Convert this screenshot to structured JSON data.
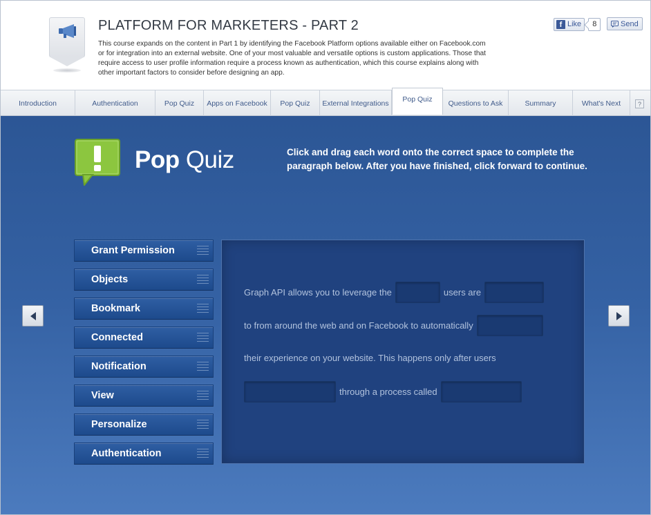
{
  "header": {
    "title": "PLATFORM FOR MARKETERS - PART 2",
    "description": "This course expands on the content in Part 1 by identifying the Facebook Platform options available either on Facebook.com or for integration into an external website. One of your most valuable and versatile options is custom applications. Those that require access to user profile information require a process known as authentication, which this course explains along with other important factors to consider before designing an app.",
    "like_label": "Like",
    "like_count": "8",
    "send_label": "Send"
  },
  "nav": {
    "tabs": [
      {
        "label": "Introduction"
      },
      {
        "label": "Authentication"
      },
      {
        "label": "Pop Quiz"
      },
      {
        "label": "Apps on Facebook"
      },
      {
        "label": "Pop Quiz"
      },
      {
        "label": "External Integrations"
      },
      {
        "label": "Pop Quiz"
      },
      {
        "label": "Questions to Ask"
      },
      {
        "label": "Summary"
      },
      {
        "label": "What's Next"
      }
    ],
    "active_index": 6,
    "help_label": "?"
  },
  "quiz": {
    "title_bold": "Pop",
    "title_light": " Quiz",
    "instructions": "Click and drag each word onto the correct space to complete the paragraph below. After you have finished, click forward to continue.",
    "words": [
      "Grant Permission",
      "Objects",
      "Bookmark",
      "Connected",
      "Notification",
      "View",
      "Personalize",
      "Authentication"
    ],
    "paragraph": {
      "l1a": "Graph API allows you to leverage the",
      "l1b": "users are",
      "l2a": "to from around the web and on Facebook to automatically",
      "l3a": "their experience on your website. This happens only after users",
      "l4a": "through a process called"
    }
  },
  "colors": {
    "accent_green": "#8cc63f",
    "stage_blue": "#3461a3",
    "link_blue": "#3f5a8a"
  }
}
